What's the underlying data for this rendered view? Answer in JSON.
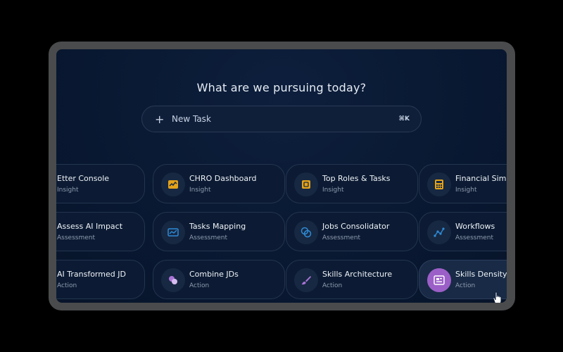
{
  "heading": "What are we pursuing today?",
  "new_task": {
    "label": "New Task",
    "shortcut": "⌘K"
  },
  "cards": [
    {
      "title": "Etter Console",
      "subtitle": "Insight"
    },
    {
      "title": "CHRO Dashboard",
      "subtitle": "Insight",
      "icon": "chart-line-icon",
      "color": "#e3a21a"
    },
    {
      "title": "Top Roles & Tasks",
      "subtitle": "Insight",
      "icon": "trophy-icon",
      "color": "#e3a21a"
    },
    {
      "title": "Financial Simu",
      "subtitle": "Insight",
      "icon": "calculator-icon",
      "color": "#e3a21a"
    },
    {
      "title": "Assess AI Impact",
      "subtitle": "Assessment"
    },
    {
      "title": "Tasks Mapping",
      "subtitle": "Assessment",
      "icon": "tasks-chart-icon",
      "color": "#2e8bd6"
    },
    {
      "title": "Jobs Consolidator",
      "subtitle": "Assessment",
      "icon": "merge-circles-icon",
      "color": "#2e8bd6"
    },
    {
      "title": "Workflows",
      "subtitle": "Assessment",
      "icon": "workflow-icon",
      "color": "#2e8bd6"
    },
    {
      "title": "AI Transformed JD",
      "subtitle": "Action"
    },
    {
      "title": "Combine JDs",
      "subtitle": "Action",
      "icon": "combine-icon",
      "color": "#a974d6"
    },
    {
      "title": "Skills Architecture",
      "subtitle": "Action",
      "icon": "brush-icon",
      "color": "#a974d6"
    },
    {
      "title": "Skills Density &",
      "subtitle": "Action",
      "icon": "density-icon",
      "color": "#ffffff"
    }
  ]
}
